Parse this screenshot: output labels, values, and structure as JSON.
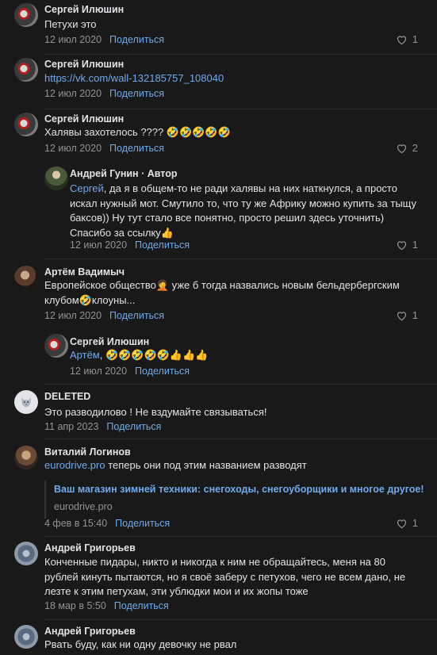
{
  "share_label": "Поделиться",
  "comments": [
    {
      "author": "Сергей Илюшин",
      "text": "Петухи это",
      "date": "12 июл 2020",
      "likes": "1",
      "avatar": "moto-avatar"
    },
    {
      "author": "Сергей Илюшин",
      "link": "https://vk.com/wall-132185757_108040",
      "date": "12 июл 2020",
      "avatar": "moto-avatar"
    },
    {
      "author": "Сергей Илюшин",
      "text": "Халявы захотелось ???? 🤣🤣🤣🤣🤣",
      "date": "12 июл 2020",
      "likes": "2",
      "avatar": "moto-avatar"
    },
    {
      "author": "Андрей Гунин · Автор",
      "reply_to": "Сергей",
      "text": ", да я в общем-то не ради халявы на них наткнулся, а просто искал нужный мот. Смутило то, что ту же Африку можно купить за тыщу баксов)) Ну тут стало все понятно, просто решил здесь уточнить) Спасибо за ссылку👍",
      "date": "12 июл 2020",
      "likes": "1",
      "avatar": "person-avatar"
    },
    {
      "author": "Артём Вадимыч",
      "text": "Европейское общество🤦 уже б тогда назвались новым бельдербергским клубом🤣клоуны...",
      "date": "12 июл 2020",
      "likes": "1",
      "avatar": "person-avatar"
    },
    {
      "author": "Сергей Илюшин",
      "reply_to": "Артём",
      "text": ", 🤣🤣🤣🤣🤣👍👍👍",
      "date": "12 июл 2020",
      "avatar": "moto-avatar"
    },
    {
      "author": "DELETED",
      "text": "Это разводилово ! Не вздумайте связываться!",
      "date": "11 апр 2023",
      "avatar": "deleted-dog-avatar"
    },
    {
      "author": "Виталий Логинов",
      "link": "eurodrive.pro",
      "text": " теперь они под этим названием разводят",
      "snippet_title": "Ваш магазин зимней техники: снегоходы, снегоуборщики и многое другое!",
      "snippet_domain": "eurodrive.pro",
      "date": "4 фев в 15:40",
      "likes": "1",
      "avatar": "person-avatar"
    },
    {
      "author": "Андрей Григорьев",
      "text": "Конченные пидары, никто и никогда к ним не обращайтесь, меня на 80 рублей кинуть пытаются, но я своё заберу с петухов, чего не всем дано, не лезте к этим петухам, эти ублюдки мои и их жопы тоже",
      "date": "18 мар в 5:50",
      "avatar": "person-avatar"
    },
    {
      "author": "Андрей Григорьев",
      "text": "Рвать буду, как ни одну девочку не рвал",
      "avatar": "person-avatar"
    }
  ]
}
